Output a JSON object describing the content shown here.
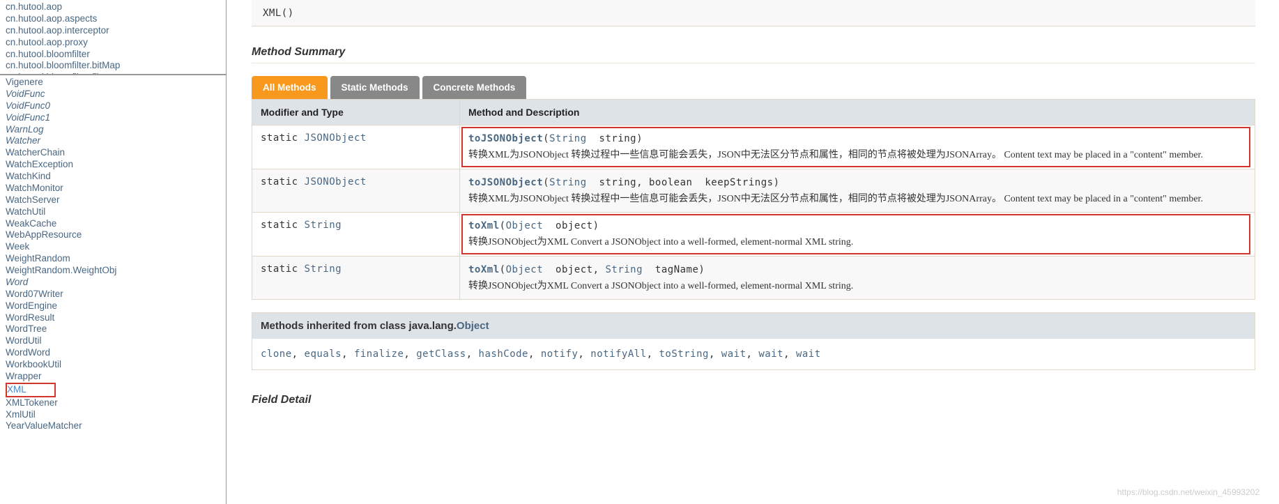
{
  "packages": [
    "cn.hutool.aop",
    "cn.hutool.aop.aspects",
    "cn.hutool.aop.interceptor",
    "cn.hutool.aop.proxy",
    "cn.hutool.bloomfilter",
    "cn.hutool.bloomfilter.bitMap",
    "cn.hutool.bloomfilter.filter"
  ],
  "classes": [
    {
      "name": "Vigenere",
      "italic": false
    },
    {
      "name": "VoidFunc",
      "italic": true
    },
    {
      "name": "VoidFunc0",
      "italic": true
    },
    {
      "name": "VoidFunc1",
      "italic": true
    },
    {
      "name": "WarnLog",
      "italic": true
    },
    {
      "name": "Watcher",
      "italic": true
    },
    {
      "name": "WatcherChain",
      "italic": false
    },
    {
      "name": "WatchException",
      "italic": false
    },
    {
      "name": "WatchKind",
      "italic": false
    },
    {
      "name": "WatchMonitor",
      "italic": false
    },
    {
      "name": "WatchServer",
      "italic": false
    },
    {
      "name": "WatchUtil",
      "italic": false
    },
    {
      "name": "WeakCache",
      "italic": false
    },
    {
      "name": "WebAppResource",
      "italic": false
    },
    {
      "name": "Week",
      "italic": false
    },
    {
      "name": "WeightRandom",
      "italic": false
    },
    {
      "name": "WeightRandom.WeightObj",
      "italic": false
    },
    {
      "name": "Word",
      "italic": true
    },
    {
      "name": "Word07Writer",
      "italic": false
    },
    {
      "name": "WordEngine",
      "italic": false
    },
    {
      "name": "WordResult",
      "italic": false
    },
    {
      "name": "WordTree",
      "italic": false
    },
    {
      "name": "WordUtil",
      "italic": false
    },
    {
      "name": "WordWord",
      "italic": false
    },
    {
      "name": "WorkbookUtil",
      "italic": false
    },
    {
      "name": "Wrapper",
      "italic": false
    },
    {
      "name": "XML",
      "italic": false,
      "selected": true
    },
    {
      "name": "XMLTokener",
      "italic": false
    },
    {
      "name": "XmlUtil",
      "italic": false
    },
    {
      "name": "YearValueMatcher",
      "italic": false
    }
  ],
  "constructor_sig": "XML()",
  "section_method_summary": "Method Summary",
  "tabs": {
    "all": "All Methods",
    "static": "Static Methods",
    "concrete": "Concrete Methods"
  },
  "table_headers": {
    "modifier": "Modifier and Type",
    "method": "Method and Description"
  },
  "methods": [
    {
      "modifier_prefix": "static ",
      "return_type": "JSONObject",
      "name": "toJSONObject",
      "params": [
        {
          "type": "String",
          "name": "string"
        }
      ],
      "desc": "转换XML为JSONObject 转换过程中一些信息可能会丢失，JSON中无法区分节点和属性，相同的节点将被处理为JSONArray。 Content text may be placed in a \"content\" member.",
      "highlight": true,
      "alt": false
    },
    {
      "modifier_prefix": "static ",
      "return_type": "JSONObject",
      "name": "toJSONObject",
      "params": [
        {
          "type": "String",
          "name": "string"
        },
        {
          "type_raw": "boolean",
          "name": "keepStrings"
        }
      ],
      "desc": "转换XML为JSONObject 转换过程中一些信息可能会丢失，JSON中无法区分节点和属性，相同的节点将被处理为JSONArray。 Content text may be placed in a \"content\" member.",
      "highlight": false,
      "alt": true
    },
    {
      "modifier_prefix": "static ",
      "return_type": "String",
      "name": "toXml",
      "params": [
        {
          "type": "Object",
          "name": "object"
        }
      ],
      "desc": "转换JSONObject为XML Convert a JSONObject into a well-formed, element-normal XML string.",
      "highlight": true,
      "alt": false
    },
    {
      "modifier_prefix": "static ",
      "return_type": "String",
      "name": "toXml",
      "params": [
        {
          "type": "Object",
          "name": "object"
        },
        {
          "type": "String",
          "name": "tagName"
        }
      ],
      "desc": "转换JSONObject为XML Convert a JSONObject into a well-formed, element-normal XML string.",
      "highlight": false,
      "alt": true
    }
  ],
  "inherited_title_prefix": "Methods inherited from class java.lang.",
  "inherited_title_link": "Object",
  "inherited_methods": [
    "clone",
    "equals",
    "finalize",
    "getClass",
    "hashCode",
    "notify",
    "notifyAll",
    "toString",
    "wait",
    "wait",
    "wait"
  ],
  "section_field_detail": "Field Detail",
  "watermark": "https://blog.csdn.net/weixin_45993202"
}
